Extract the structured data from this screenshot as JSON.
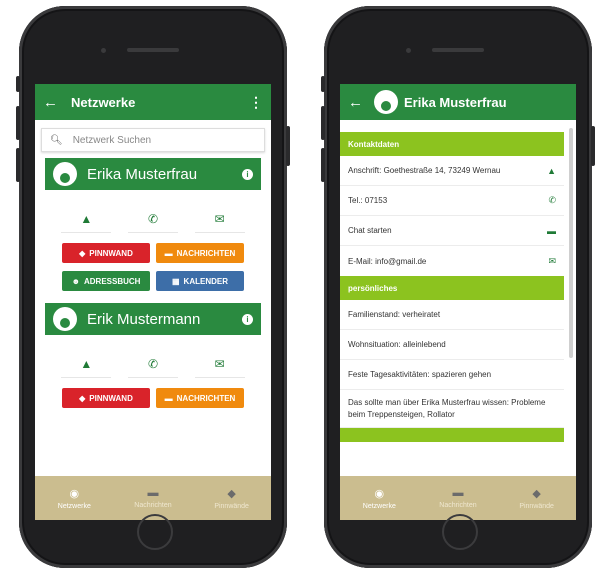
{
  "left_screen": {
    "appbar": {
      "title": "Netzwerke",
      "back_icon": "arrow-left-icon",
      "menu_glyph": "⋮"
    },
    "search": {
      "placeholder": "Netzwerk Suchen"
    },
    "people": [
      {
        "name": "Erika Musterfrau",
        "actions": [
          "PINNWAND",
          "NACHRICHTEN",
          "ADRESSBUCH",
          "KALENDER"
        ]
      },
      {
        "name": "Erik Mustermann",
        "actions": [
          "PINNWAND",
          "NACHRICHTEN"
        ]
      }
    ]
  },
  "right_screen": {
    "appbar": {
      "title": "Erika Musterfrau"
    },
    "sections": [
      {
        "title": "Kontaktdaten",
        "rows": [
          {
            "text": "Anschrift: Goethestraße 14, 73249 Wernau",
            "icon": "navigation-icon"
          },
          {
            "text": "Tel.: 07153",
            "icon": "phone-icon"
          },
          {
            "text": "Chat starten",
            "icon": "chat-icon"
          },
          {
            "text": "E-Mail: info@gmail.de",
            "icon": "mail-icon"
          }
        ]
      },
      {
        "title": "persönliches",
        "rows": [
          {
            "text": "Familienstand: verheiratet"
          },
          {
            "text": "Wohnsituation: alleinlebend"
          },
          {
            "text": "Feste Tagesaktivitäten: spazieren gehen"
          },
          {
            "text": "Das sollte man über Erika Musterfrau wissen: Probleme beim Treppensteigen, Rollator"
          }
        ]
      }
    ]
  },
  "bottom_nav": [
    {
      "label": "Netzwerke",
      "icon": "radio-target-icon",
      "active": true
    },
    {
      "label": "Nachrichten",
      "icon": "chat-icon",
      "active": false
    },
    {
      "label": "Pinnwände",
      "icon": "tag-icon",
      "active": false
    }
  ],
  "colors": {
    "primary_green": "#2a8a40",
    "lime": "#8cc31f",
    "red": "#d9232a",
    "orange": "#f08a0e",
    "blue": "#3d6ea8",
    "nav_bg": "#cbbd8f"
  }
}
